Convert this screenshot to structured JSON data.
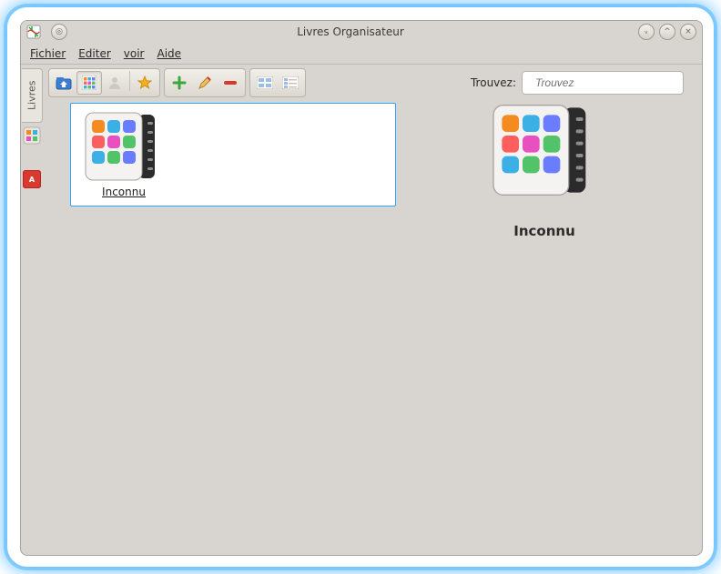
{
  "window": {
    "title": "Livres Organisateur",
    "min_tip": "–",
    "max_tip": "^",
    "close_tip": "×"
  },
  "menu": {
    "fichier": "Fichier",
    "editer": "Editer",
    "voir": "voir",
    "aide": "Aide"
  },
  "sidebar": {
    "tab_livres": "Livres"
  },
  "search": {
    "label": "Trouvez:",
    "placeholder": "Trouvez"
  },
  "books": {
    "items": [
      {
        "label": "Inconnu"
      }
    ]
  },
  "detail": {
    "title": "Inconnu"
  }
}
